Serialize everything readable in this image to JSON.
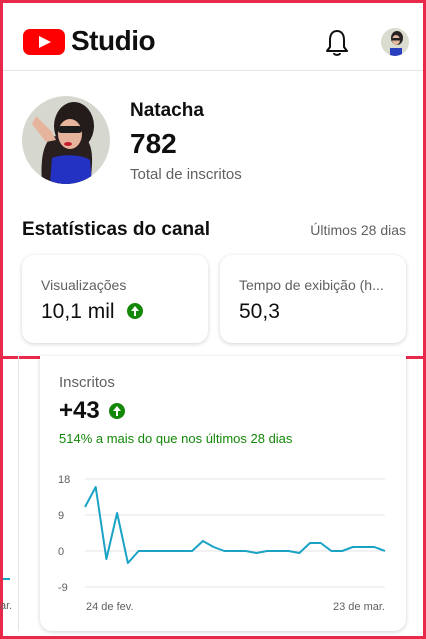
{
  "header": {
    "logo_text": "Studio",
    "brand_color": "#ff0000"
  },
  "profile": {
    "channel_name": "Natacha",
    "subscriber_count": "782",
    "subscriber_label": "Total de inscritos"
  },
  "stats": {
    "title": "Estatísticas do canal",
    "period": "Últimos 28 dias",
    "cards": [
      {
        "label": "Visualizações",
        "value": "10,1 mil",
        "trend": "up"
      },
      {
        "label": "Tempo de exibição (h...",
        "value": "50,3"
      }
    ]
  },
  "subscribers_card": {
    "label": "Inscritos",
    "value": "+43",
    "trend": "up",
    "note": "514% a mais do que nos últimos 28 dias",
    "note_color": "#138808"
  },
  "partial_left": {
    "date_fragment": "ar."
  },
  "chart_data": {
    "type": "line",
    "ylim": [
      -9,
      18
    ],
    "yticks": [
      "18",
      "9",
      "0",
      "-9"
    ],
    "xlabels": [
      "24 de fev.",
      "23 de mar."
    ],
    "line_color": "#1aa3c5",
    "series": [
      {
        "values": [
          11,
          16,
          -2,
          9.5,
          -3,
          0,
          0,
          0,
          0,
          0,
          0,
          2.5,
          1,
          0,
          0,
          0,
          -0.5,
          0,
          0,
          0,
          -0.5,
          2,
          2,
          0,
          0,
          1,
          1,
          1,
          0
        ]
      }
    ]
  }
}
